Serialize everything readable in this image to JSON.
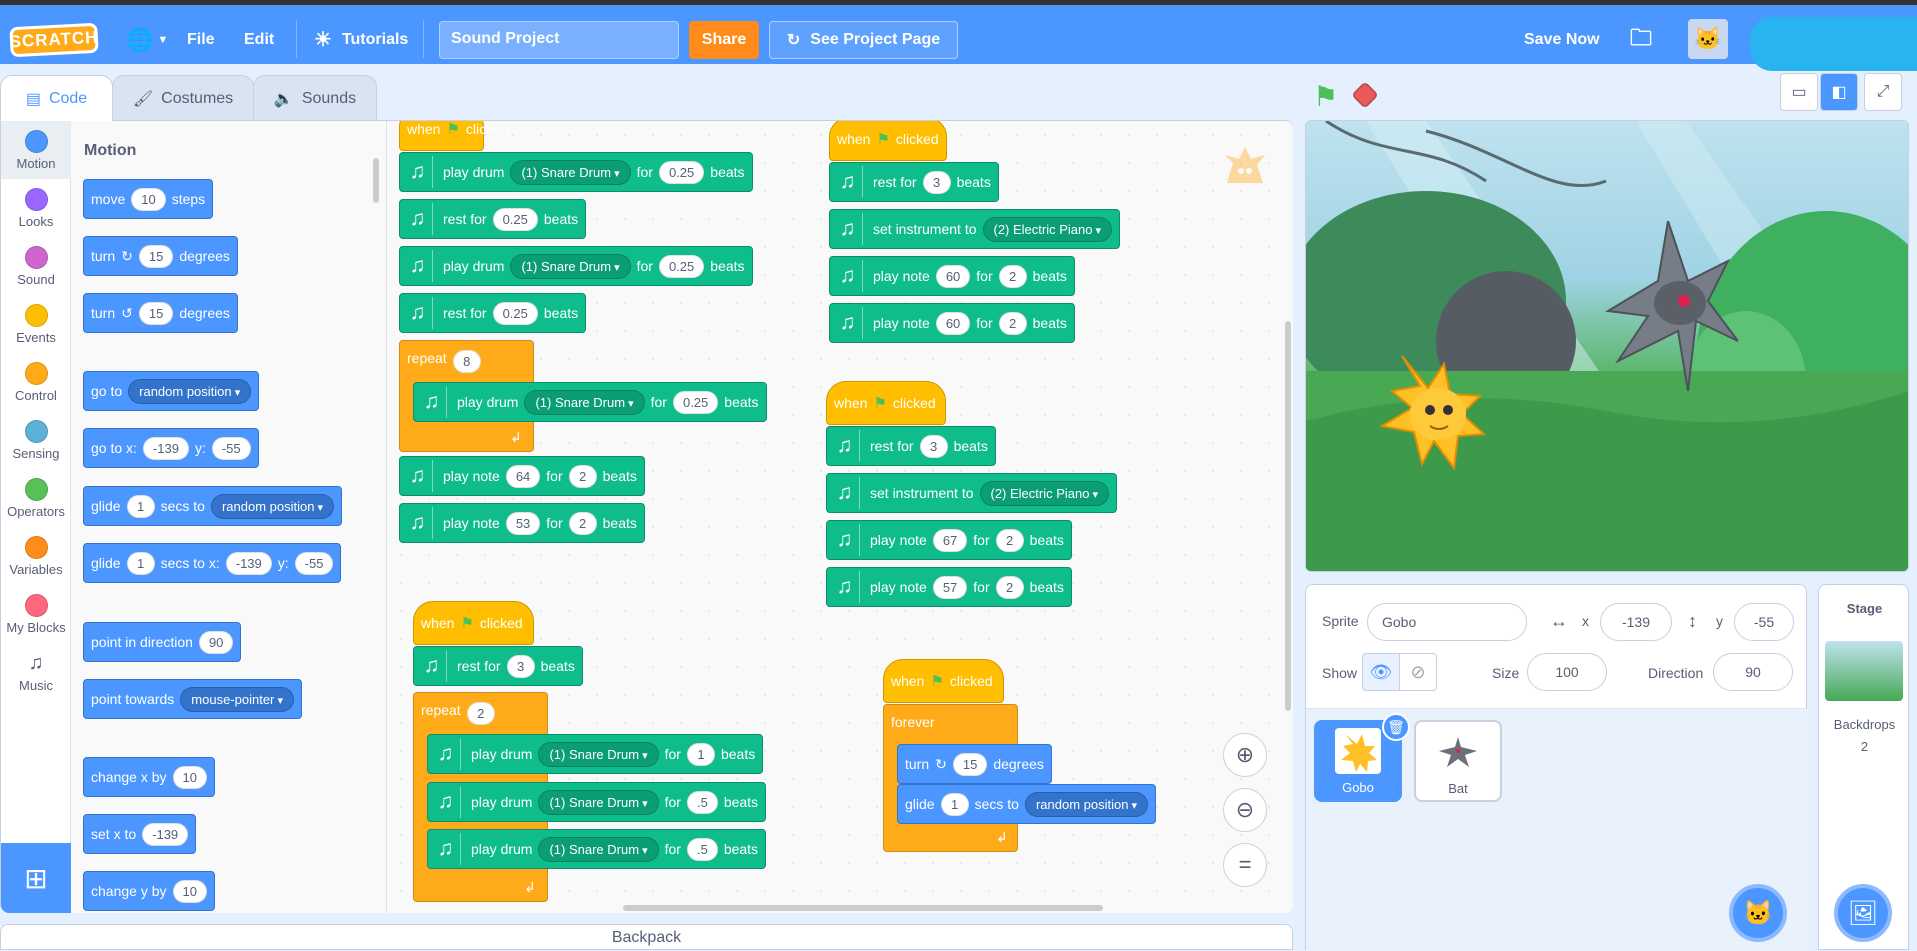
{
  "topbar": {
    "logo_text": "SCRATCH",
    "file": "File",
    "edit": "Edit",
    "tutorials": "Tutorials",
    "project_title": "Sound Project",
    "share": "Share",
    "see_project_page": "See Project Page",
    "save_now": "Save Now"
  },
  "tabs": {
    "code": "Code",
    "costumes": "Costumes",
    "sounds": "Sounds"
  },
  "categories": [
    "Motion",
    "Looks",
    "Sound",
    "Events",
    "Control",
    "Sensing",
    "Operators",
    "Variables",
    "My Blocks",
    "Music"
  ],
  "category_colors": [
    "#4c97ff",
    "#9966ff",
    "#cf63cf",
    "#ffbf00",
    "#ffab19",
    "#5cb1d6",
    "#59c059",
    "#ff8c1a",
    "#ff6680",
    "#0fbd8c"
  ],
  "palette": {
    "title": "Motion",
    "move": {
      "a": "move",
      "v": "10",
      "b": "steps"
    },
    "turn_cw": {
      "a": "turn",
      "v": "15",
      "b": "degrees"
    },
    "turn_ccw": {
      "a": "turn",
      "v": "15",
      "b": "degrees"
    },
    "goto": {
      "a": "go to",
      "d": "random position"
    },
    "gotoxy": {
      "a": "go to x:",
      "x": "-139",
      "b": "y:",
      "y": "-55"
    },
    "glide1": {
      "a": "glide",
      "v": "1",
      "b": "secs to",
      "d": "random position"
    },
    "glide2": {
      "a": "glide",
      "v": "1",
      "b": "secs to x:",
      "x": "-139",
      "c": "y:",
      "y": "-55"
    },
    "point_dir": {
      "a": "point in direction",
      "v": "90"
    },
    "point_towards": {
      "a": "point towards",
      "d": "mouse-pointer"
    },
    "change_x": {
      "a": "change x by",
      "v": "10"
    },
    "set_x": {
      "a": "set x to",
      "v": "-139"
    },
    "change_y": {
      "a": "change y by",
      "v": "10"
    }
  },
  "script_words": {
    "when": "when",
    "clicked": "clicked",
    "play_drum": "play drum",
    "for": "for",
    "beats": "beats",
    "rest_for": "rest for",
    "repeat": "repeat",
    "play_note": "play note",
    "set_instrument": "set instrument to",
    "forever": "forever",
    "turn": "turn",
    "degrees": "degrees",
    "glide": "glide",
    "secs_to": "secs to"
  },
  "scripts": {
    "snare": "(1) Snare Drum",
    "piano": "(2) Electric Piano",
    "random": "random position",
    "s1": {
      "d1": "0.25",
      "r1": "0.25",
      "d2": "0.25",
      "r2": "0.25",
      "rep": "8",
      "d3": "0.25",
      "n1": "64",
      "n1b": "2",
      "n2": "53",
      "n2b": "2"
    },
    "s2": {
      "rest": "3",
      "n1": "60",
      "n1b": "2",
      "n2": "60",
      "n2b": "2"
    },
    "s3": {
      "rest": "3",
      "n1": "67",
      "n1b": "2",
      "n2": "57",
      "n2b": "2"
    },
    "s4": {
      "rest": "3",
      "rep": "2",
      "d1": "1",
      "d2": ".5",
      "d3": ".5"
    },
    "s5": {
      "turn": "15",
      "glide": "1"
    }
  },
  "backpack": "Backpack",
  "sprite_info": {
    "sprite_label": "Sprite",
    "sprite_name": "Gobo",
    "x_label": "x",
    "x": "-139",
    "y_label": "y",
    "y": "-55",
    "show_label": "Show",
    "size_label": "Size",
    "size": "100",
    "direction_label": "Direction",
    "direction": "90"
  },
  "sprites": [
    {
      "name": "Gobo"
    },
    {
      "name": "Bat"
    }
  ],
  "stage_panel": {
    "title": "Stage",
    "backdrops_label": "Backdrops",
    "backdrops_count": "2"
  },
  "colors": {
    "accent": "#4c97ff",
    "motion": "#4c97ff",
    "music": "#0fbd8c",
    "events": "#ffbf00",
    "control": "#ffab19"
  }
}
